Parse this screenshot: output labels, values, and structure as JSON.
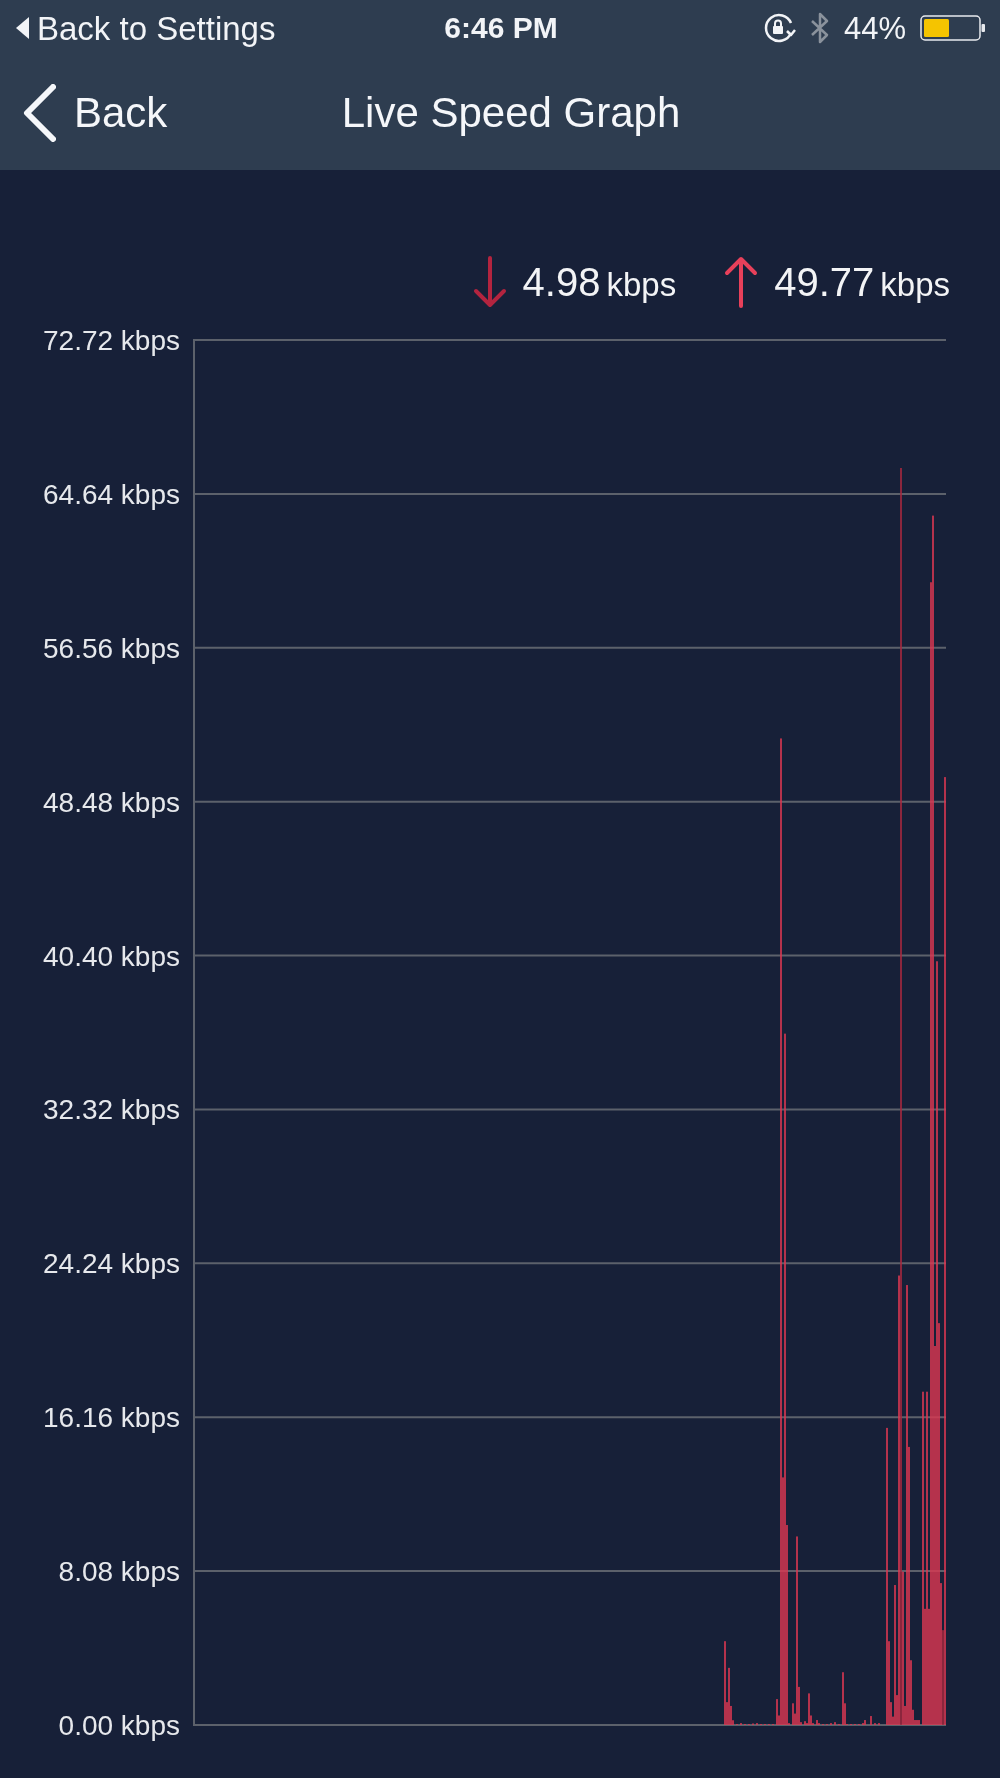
{
  "status_bar": {
    "back_label": "Back to Settings",
    "time": "6:46 PM",
    "battery": "44%"
  },
  "nav_bar": {
    "back_button": "Back",
    "title": "Live Speed Graph"
  },
  "legend": [
    {
      "kind": "download",
      "color": "#b3243f",
      "value": "4.98",
      "unit": "kbps"
    },
    {
      "kind": "upload",
      "color": "#e8405a",
      "value": "49.77",
      "unit": "kbps"
    }
  ],
  "chart": {
    "chart_data": {
      "type": "bar",
      "grid": true,
      "categories": [
        null,
        null,
        null,
        null,
        null,
        null,
        null,
        null,
        null,
        null,
        null,
        null,
        null,
        null,
        null,
        null,
        null,
        null,
        null,
        null,
        null,
        null,
        null,
        null,
        null,
        null,
        null,
        null,
        null,
        null,
        null,
        null,
        null,
        null,
        null,
        null,
        null,
        null,
        null,
        null,
        null,
        null,
        null,
        null,
        null,
        null,
        null,
        null,
        null,
        null,
        null,
        null,
        null,
        null,
        null,
        null,
        null,
        null,
        null,
        null,
        null,
        null,
        null,
        null,
        null,
        null,
        null,
        null,
        null,
        null,
        null,
        null,
        null,
        null,
        null,
        null,
        null,
        null,
        null,
        null,
        null,
        null,
        null,
        null,
        null,
        null,
        null,
        null,
        null,
        null,
        null,
        null,
        null,
        null,
        null,
        null,
        null,
        null,
        null,
        null,
        null,
        null,
        null,
        null,
        null,
        null,
        null,
        null,
        null,
        null,
        null,
        null,
        null,
        null,
        null,
        null,
        null,
        null,
        null,
        null,
        null,
        null,
        null,
        null,
        null,
        null,
        null,
        null,
        null,
        null,
        null,
        null,
        null,
        null,
        null,
        null,
        null,
        null,
        null,
        null,
        null,
        null,
        null,
        null,
        null,
        null,
        null,
        null,
        null,
        null,
        null,
        null,
        null,
        null,
        null,
        null,
        null,
        null,
        null,
        null,
        null,
        null,
        null,
        null,
        null,
        null,
        null,
        null,
        null,
        null,
        null,
        null,
        null,
        null,
        null,
        null,
        null,
        null,
        null,
        null,
        null,
        null,
        null,
        null,
        null,
        null,
        null,
        null,
        null,
        null,
        null,
        null,
        null,
        null,
        null,
        null,
        null,
        null,
        null,
        null,
        null,
        null,
        null,
        null,
        null,
        null,
        null,
        null,
        null,
        null,
        null,
        null,
        null,
        null,
        null,
        null,
        null,
        null,
        null,
        null,
        null,
        null,
        null,
        null,
        null,
        null,
        null,
        null,
        null,
        null,
        null,
        null,
        null,
        null,
        null,
        null,
        null,
        null,
        null,
        null,
        null,
        null,
        null,
        null,
        null,
        null,
        null,
        null,
        null,
        null,
        null,
        null,
        null,
        null,
        null,
        null,
        null,
        null,
        null,
        null,
        null,
        null,
        null,
        null,
        null,
        null,
        null,
        null,
        null,
        null,
        null,
        null,
        null,
        null,
        null,
        null,
        null,
        null,
        null,
        null,
        null,
        null,
        null,
        null,
        null,
        null,
        null,
        null,
        null,
        null,
        null,
        null,
        null,
        null,
        null,
        null,
        null,
        null,
        null,
        null,
        null,
        null,
        null,
        null,
        null,
        null,
        null,
        null,
        null,
        null,
        null,
        null,
        null,
        null,
        null,
        null,
        null,
        null,
        null,
        null,
        null,
        null,
        null,
        null,
        null,
        null,
        null,
        null,
        null,
        null,
        null,
        null,
        null,
        null,
        null,
        null,
        null,
        null,
        null,
        null,
        null,
        null,
        null,
        null,
        null,
        null,
        null,
        null,
        null,
        null,
        null,
        null,
        null,
        null,
        null,
        null,
        null,
        null,
        null,
        null,
        null,
        null,
        null,
        null,
        null,
        null,
        null,
        null,
        null,
        null,
        null,
        null,
        null,
        null,
        null,
        null
      ],
      "ylim": [
        0,
        72.72
      ],
      "yticks": [
        {
          "value": 72.72,
          "label": "72.72 kbps"
        },
        {
          "value": 64.64,
          "label": "64.64 kbps"
        },
        {
          "value": 56.56,
          "label": "56.56 kbps"
        },
        {
          "value": 48.48,
          "label": "48.48 kbps"
        },
        {
          "value": 40.4,
          "label": "40.40 kbps"
        },
        {
          "value": 32.32,
          "label": "32.32 kbps"
        },
        {
          "value": 24.24,
          "label": "24.24 kbps"
        },
        {
          "value": 16.16,
          "label": "16.16 kbps"
        },
        {
          "value": 8.08,
          "label": "8.08 kbps"
        },
        {
          "value": 0,
          "label": "0.00 kbps"
        }
      ],
      "series": [
        {
          "color": "#a8283f",
          "values": [
            null,
            null,
            null,
            null,
            null,
            null,
            null,
            null,
            null,
            null,
            null,
            null,
            null,
            null,
            null,
            null,
            null,
            null,
            null,
            null,
            null,
            null,
            null,
            null,
            null,
            null,
            null,
            null,
            null,
            null,
            null,
            null,
            null,
            null,
            null,
            null,
            null,
            null,
            null,
            null,
            null,
            null,
            null,
            null,
            null,
            null,
            null,
            null,
            null,
            null,
            null,
            null,
            null,
            null,
            null,
            null,
            null,
            null,
            null,
            null,
            null,
            null,
            null,
            null,
            null,
            null,
            null,
            null,
            null,
            null,
            null,
            null,
            null,
            null,
            null,
            null,
            null,
            null,
            null,
            null,
            null,
            null,
            null,
            null,
            null,
            null,
            null,
            null,
            null,
            null,
            null,
            null,
            null,
            null,
            null,
            null,
            null,
            null,
            null,
            null,
            null,
            null,
            null,
            null,
            null,
            null,
            null,
            null,
            null,
            null,
            null,
            null,
            null,
            null,
            null,
            null,
            null,
            null,
            null,
            null,
            null,
            null,
            null,
            null,
            null,
            null,
            null,
            null,
            null,
            null,
            null,
            null,
            null,
            null,
            null,
            null,
            null,
            null,
            null,
            null,
            null,
            null,
            null,
            null,
            null,
            null,
            null,
            null,
            null,
            null,
            null,
            null,
            null,
            null,
            null,
            null,
            null,
            null,
            null,
            null,
            null,
            null,
            null,
            null,
            null,
            null,
            null,
            null,
            null,
            null,
            null,
            null,
            null,
            null,
            null,
            null,
            null,
            null,
            null,
            null,
            null,
            null,
            null,
            null,
            null,
            null,
            null,
            null,
            null,
            null,
            null,
            null,
            null,
            null,
            null,
            null,
            null,
            null,
            null,
            null,
            null,
            null,
            null,
            null,
            null,
            null,
            null,
            null,
            null,
            null,
            null,
            null,
            null,
            null,
            null,
            null,
            null,
            null,
            null,
            null,
            null,
            null,
            null,
            null,
            null,
            null,
            null,
            null,
            null,
            null,
            null,
            null,
            null,
            null,
            null,
            null,
            null,
            null,
            null,
            null,
            null,
            null,
            null,
            null,
            null,
            null,
            null,
            null,
            null,
            null,
            null,
            null,
            null,
            null,
            null,
            null,
            null,
            null,
            null,
            null,
            null,
            null,
            null,
            null,
            null,
            null,
            null,
            null,
            null,
            null,
            null,
            null,
            null,
            null,
            null,
            null,
            null,
            null,
            null,
            null,
            null,
            null,
            null,
            null,
            null,
            null,
            null,
            null,
            null,
            null,
            null,
            null,
            null,
            null,
            null,
            null,
            null,
            null,
            null,
            null,
            null,
            null,
            null,
            null,
            null,
            null,
            null,
            null,
            null,
            null,
            null,
            null,
            null,
            null,
            null,
            null,
            null,
            null,
            null,
            null,
            null,
            null,
            null,
            null,
            null,
            null,
            null,
            null,
            null,
            null,
            null,
            null,
            null,
            null,
            null,
            null,
            null,
            null,
            null,
            null,
            null,
            null,
            null,
            null,
            null,
            null,
            null,
            null,
            null,
            null,
            null,
            null,
            null,
            66.0,
            null,
            null,
            null,
            null,
            null,
            null,
            null,
            null,
            null,
            null,
            null,
            null,
            null,
            null,
            null,
            null,
            null,
            null,
            null,
            null,
            4.98,
            null
          ]
        },
        {
          "color": "#dc3752",
          "values": [
            null,
            null,
            null,
            null,
            null,
            null,
            null,
            null,
            null,
            null,
            null,
            null,
            null,
            null,
            null,
            null,
            null,
            null,
            null,
            null,
            null,
            null,
            null,
            null,
            null,
            null,
            null,
            null,
            null,
            null,
            null,
            null,
            null,
            null,
            null,
            null,
            null,
            null,
            null,
            null,
            null,
            null,
            null,
            null,
            null,
            null,
            null,
            null,
            null,
            null,
            null,
            null,
            null,
            null,
            null,
            null,
            null,
            null,
            null,
            null,
            null,
            null,
            null,
            null,
            null,
            null,
            null,
            null,
            null,
            null,
            null,
            null,
            null,
            null,
            null,
            null,
            null,
            null,
            null,
            null,
            null,
            null,
            null,
            null,
            null,
            null,
            null,
            null,
            null,
            null,
            null,
            null,
            null,
            null,
            null,
            null,
            null,
            null,
            null,
            null,
            null,
            null,
            null,
            null,
            null,
            null,
            null,
            null,
            null,
            null,
            null,
            null,
            null,
            null,
            null,
            null,
            null,
            null,
            null,
            null,
            null,
            null,
            null,
            null,
            null,
            null,
            null,
            null,
            null,
            null,
            null,
            null,
            null,
            null,
            null,
            null,
            null,
            null,
            null,
            null,
            null,
            null,
            null,
            null,
            null,
            null,
            null,
            null,
            null,
            null,
            null,
            null,
            null,
            null,
            null,
            null,
            null,
            null,
            null,
            null,
            null,
            null,
            null,
            null,
            null,
            null,
            null,
            null,
            null,
            null,
            null,
            null,
            null,
            null,
            null,
            null,
            null,
            null,
            null,
            null,
            null,
            null,
            null,
            null,
            null,
            null,
            null,
            null,
            null,
            null,
            null,
            null,
            null,
            null,
            null,
            null,
            null,
            null,
            null,
            null,
            null,
            null,
            null,
            null,
            null,
            null,
            null,
            null,
            null,
            null,
            null,
            null,
            null,
            null,
            null,
            null,
            null,
            null,
            null,
            null,
            null,
            null,
            null,
            null,
            null,
            null,
            null,
            null,
            null,
            null,
            null,
            null,
            null,
            null,
            null,
            null,
            null,
            null,
            null,
            null,
            null,
            null,
            null,
            null,
            null,
            null,
            null,
            null,
            null,
            null,
            null,
            null,
            null,
            null,
            null,
            null,
            null,
            null,
            null,
            null,
            null,
            null,
            null,
            null,
            null,
            4.4,
            1.2,
            3.0,
            1.0,
            0.25,
            null,
            0.05,
            null,
            0.1,
            null,
            0.05,
            null,
            0.05,
            null,
            0.08,
            null,
            0.1,
            null,
            0.05,
            null,
            0.05,
            null,
            0.05,
            null,
            0.05,
            null,
            1.36,
            0.5,
            51.8,
            13.0,
            36.3,
            10.5,
            0.1,
            null,
            1.14,
            0.6,
            9.9,
            2.0,
            0.15,
            null,
            0.2,
            0.1,
            1.66,
            0.5,
            0.1,
            null,
            0.26,
            0.1,
            null,
            0.05,
            null,
            0.05,
            null,
            0.1,
            null,
            0.15,
            null,
            0.05,
            null,
            2.77,
            1.14,
            0.05,
            null,
            0.05,
            null,
            0.05,
            null,
            0.05,
            null,
            0.1,
            0.26,
            null,
            null,
            0.47,
            null,
            0.1,
            null,
            0.1,
            null,
            null,
            null,
            15.6,
            4.4,
            1.2,
            0.44,
            7.35,
            1.57,
            23.6,
            null,
            8.05,
            1.0,
            23.1,
            14.6,
            3.4,
            0.8,
            0.26,
            0.26,
            0.26,
            null,
            17.5,
            6.1,
            17.5,
            6.1,
            60.0,
            63.5,
            19.9,
            40.1,
            21.1,
            7.45,
            null,
            49.77
          ]
        }
      ]
    }
  }
}
